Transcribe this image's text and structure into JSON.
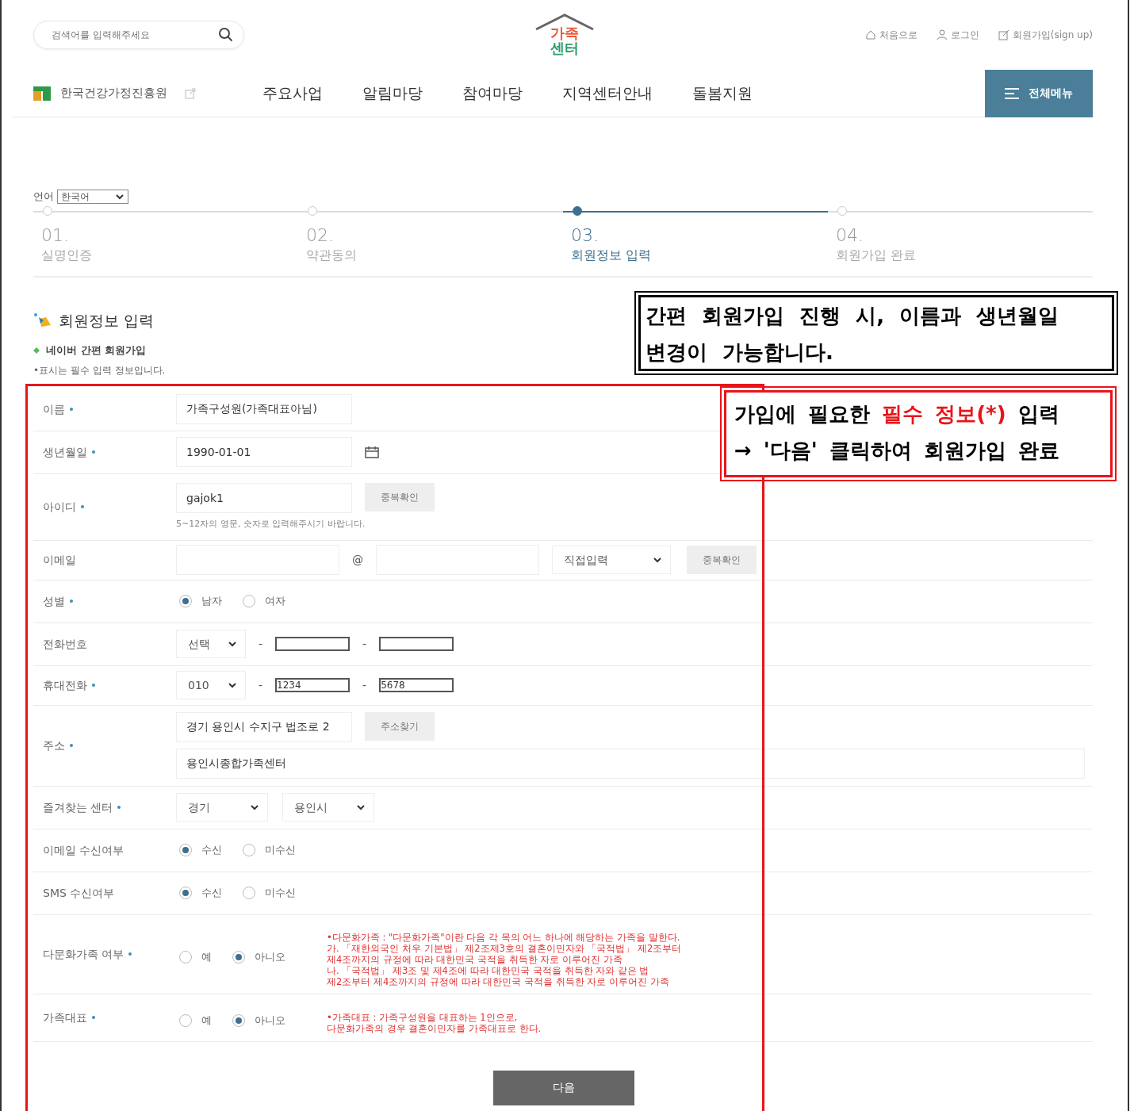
{
  "header": {
    "search": {
      "placeholder": "검색어를 입력해주세요"
    },
    "logo": {
      "top": "가족",
      "bottom": "센터"
    },
    "util_links": [
      "처음으로",
      "로그인",
      "회원가입(sign up)"
    ],
    "org": "한국건강가정진흥원",
    "nav": [
      "주요사업",
      "알림마당",
      "참여마당",
      "지역센터안내",
      "돌봄지원"
    ],
    "all_menu": "전체메뉴"
  },
  "language": {
    "label": "언어",
    "value": "한국어"
  },
  "steps": [
    {
      "num": "01.",
      "label": "실명인증",
      "selected": false
    },
    {
      "num": "02.",
      "label": "약관동의",
      "selected": false
    },
    {
      "num": "03.",
      "label": "회원정보 입력",
      "selected": true
    },
    {
      "num": "04.",
      "label": "회원가입 완료",
      "selected": false
    }
  ],
  "section": {
    "title": "회원정보 입력",
    "subtitle": "네이버 간편 회원가입",
    "note": "•표시는 필수 입력 정보입니다."
  },
  "callouts": [
    {
      "kind": "black",
      "lines": [
        [
          {
            "text": "간편 회원가입 진행 시, 이름과 생년월일",
            "highlight": false
          }
        ],
        [
          {
            "text": "변경이 가능합니다.",
            "highlight": false
          }
        ]
      ]
    },
    {
      "kind": "red",
      "lines": [
        [
          {
            "text": "가입에 필요한 ",
            "highlight": false
          },
          {
            "text": "필수 정보(*)",
            "highlight": true
          },
          {
            "text": " 입력",
            "highlight": false
          }
        ],
        [
          {
            "text": "→ '다음' 클릭하여 회원가입 완료",
            "highlight": false
          }
        ]
      ]
    }
  ],
  "rows": [
    {
      "kind": "text",
      "label": "이름",
      "required": true,
      "value": "가족구성원(가족대표아님)"
    },
    {
      "kind": "date",
      "label": "생년월일",
      "required": true,
      "value": "1990-01-01"
    },
    {
      "kind": "id",
      "label": "아이디",
      "required": true,
      "value": "gajok1",
      "button": "중복확인",
      "hint": "5~12자의 영문, 숫자로 입력해주시기 바랍니다."
    },
    {
      "kind": "email",
      "label": "이메일",
      "required": false,
      "at": "@",
      "select": "직접입력",
      "button": "중복확인"
    },
    {
      "kind": "radio",
      "label": "성별",
      "required": true,
      "options": [
        {
          "label": "남자",
          "selected": true
        },
        {
          "label": "여자",
          "selected": false
        }
      ]
    },
    {
      "kind": "phone",
      "label": "전화번호",
      "required": false,
      "select": "선택",
      "separators": [
        "-",
        "-"
      ]
    },
    {
      "kind": "phone",
      "label": "휴대전화",
      "required": true,
      "select": "010",
      "separators": [
        "-",
        "-"
      ],
      "values": [
        "1234",
        "5678"
      ]
    },
    {
      "kind": "address",
      "label": "주소",
      "required": true,
      "value": "경기 용인시 수지구 법조로 2",
      "button": "주소찾기",
      "detail": "용인시종합가족센터"
    },
    {
      "kind": "selects",
      "label": "즐겨찾는 센터",
      "required": true,
      "selects": [
        "경기",
        "용인시"
      ]
    },
    {
      "kind": "radio",
      "label": "이메일 수신여부",
      "required": false,
      "options": [
        {
          "label": "수신",
          "selected": true
        },
        {
          "label": "미수신",
          "selected": false
        }
      ]
    },
    {
      "kind": "radio",
      "label": "SMS 수신여부",
      "required": false,
      "options": [
        {
          "label": "수신",
          "selected": true
        },
        {
          "label": "미수신",
          "selected": false
        }
      ]
    },
    {
      "kind": "radio",
      "label": "다문화가족 여부",
      "required": true,
      "options": [
        {
          "label": "예",
          "selected": false
        },
        {
          "label": "아니오",
          "selected": true
        }
      ],
      "note": [
        "•다문화가족 : \"다문화가족\"이란 다음 각 목의 어느 하나에 해당하는 가족을 말한다.",
        "가. 「재한외국인 처우 기본법」 제2조제3호의 결혼이민자와 「국적법」 제2조부터",
        "제4조까지의 규정에 따라 대한민국 국적을 취득한 자로 이루어진 가족",
        "나. 「국적법」 제3조 및 제4조에 따라 대한민국 국적을 취득한 자와 같은 법",
        "제2조부터 제4조까지의 규정에 따라 대한민국 국적을 취득한 자로 이루어진 가족"
      ]
    },
    {
      "kind": "radio",
      "label": "가족대표",
      "required": true,
      "options": [
        {
          "label": "예",
          "selected": false
        },
        {
          "label": "아니오",
          "selected": true
        }
      ],
      "note": [
        "•가족대표 : 가족구성원을 대표하는 1인으로,",
        "다문화가족의 경우 결혼이민자를 가족대표로 한다."
      ]
    }
  ],
  "submit": "다음"
}
